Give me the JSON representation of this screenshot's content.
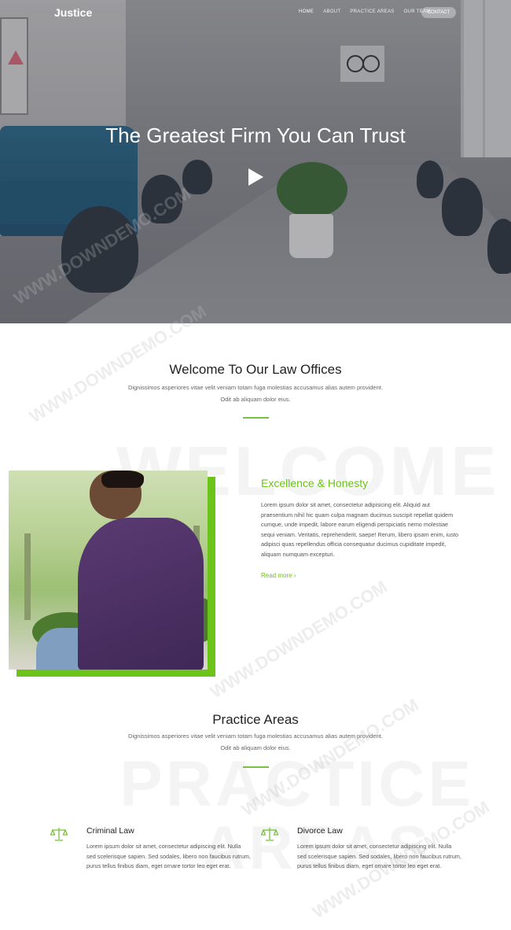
{
  "nav": {
    "logo": "Justice",
    "items": [
      "HOME",
      "ABOUT",
      "PRACTICE AREAS",
      "OUR TEAM"
    ],
    "contact": "CONTACT"
  },
  "hero": {
    "title": "The Greatest Firm You Can Trust"
  },
  "welcome": {
    "title": "Welcome To Our Law Offices",
    "subtitle": "Dignissimos asperiores vitae velit veniam totam fuga molestias accusamus alias autem provident. Odit ab aliquam dolor eius.",
    "bg_word": "WELCOME"
  },
  "excellence": {
    "title": "Excellence & Honesty",
    "text": "Lorem ipsum dolor sit amet, consectetur adipisicing elit. Aliquid aut praesentium nihil hic quam culpa magnam ducimus suscipit repellat quidem cumque, unde impedit, labore earum eligendi perspiciatis nemo molestiae sequi veniam. Veritatis, reprehenderit, saepe! Rerum, libero ipsam enim, iusto adipisci quas repellendus officia consequatur ducimus cupiditate impedit, aliquam numquam excepturi.",
    "read_more": "Read more  ›"
  },
  "practice": {
    "title": "Practice Areas",
    "subtitle": "Dignissimos asperiores vitae velit veniam totam fuga molestias accusamus alias autem provident. Odit ab aliquam dolor eius.",
    "bg_word1": "PRACTICE",
    "bg_word2": "AREAS",
    "items": [
      {
        "icon": "scales-icon",
        "title": "Criminal Law",
        "text": "Lorem ipsum dolor sit amet, consectetur adipiscing elit. Nulla sed scelerisque sapien. Sed sodales, libero non faucibus rutrum, purus tellus finibus diam, eget ornare tortor leo eget erat."
      },
      {
        "icon": "scales-icon",
        "title": "Divorce Law",
        "text": "Lorem ipsum dolor sit amet, consectetur adipiscing elit. Nulla sed scelerisque sapien. Sed sodales, libero non faucibus rutrum, purus tellus finibus diam, eget ornare tortor leo eget erat."
      }
    ]
  },
  "watermark": "WWW.DOWNDEMO.COM",
  "colors": {
    "accent": "#6cc319"
  }
}
